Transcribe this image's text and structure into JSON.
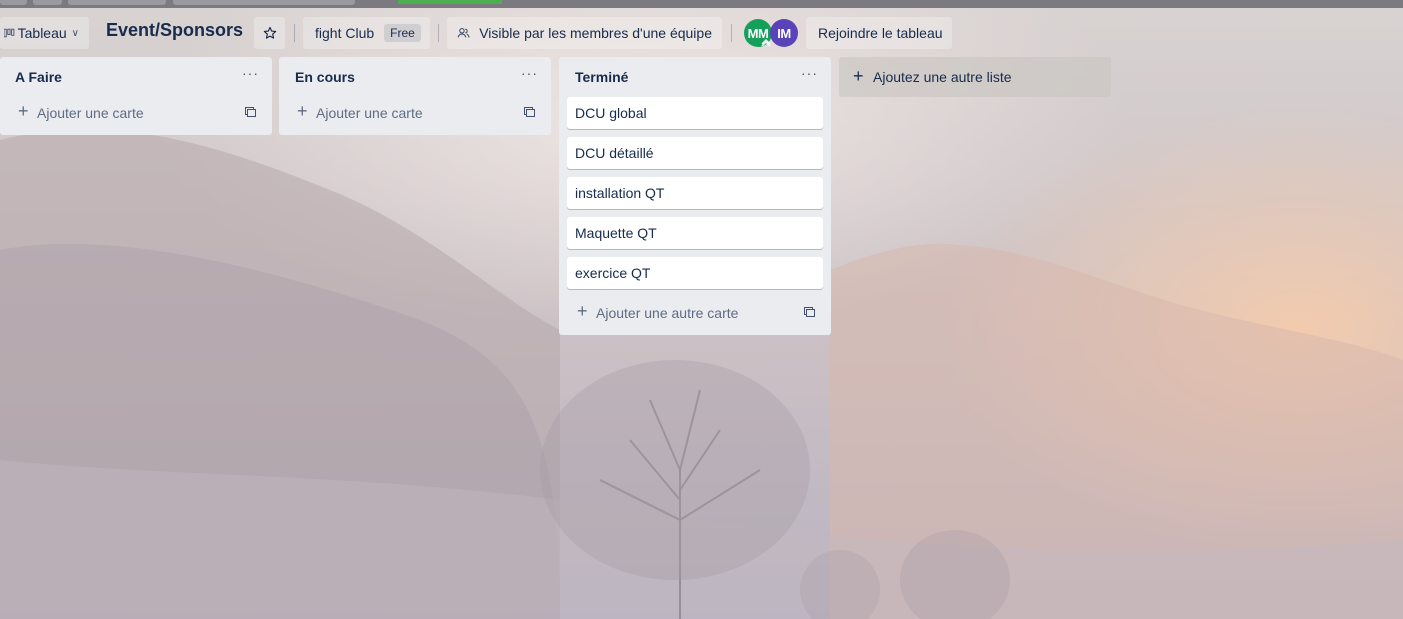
{
  "header": {
    "view_label": "Tableau",
    "board_title": "Event/Sponsors",
    "workspace_name": "fight Club",
    "plan_badge": "Free",
    "visibility_label": "Visible par les membres d'une équipe",
    "members": [
      {
        "initials": "MM",
        "color": "#14a05a"
      },
      {
        "initials": "IM",
        "color": "#5a43b8"
      }
    ],
    "join_label": "Rejoindre le tableau"
  },
  "lists": [
    {
      "title": "A Faire",
      "cards": [],
      "add_label": "Ajouter une carte"
    },
    {
      "title": "En cours",
      "cards": [],
      "add_label": "Ajouter une carte"
    },
    {
      "title": "Terminé",
      "cards": [
        "DCU global",
        "DCU détaillé",
        "installation QT",
        "Maquette QT",
        "exercice QT"
      ],
      "add_label": "Ajouter une autre carte"
    }
  ],
  "list_menu_glyph": "···",
  "add_list_label": "Ajoutez une autre liste"
}
